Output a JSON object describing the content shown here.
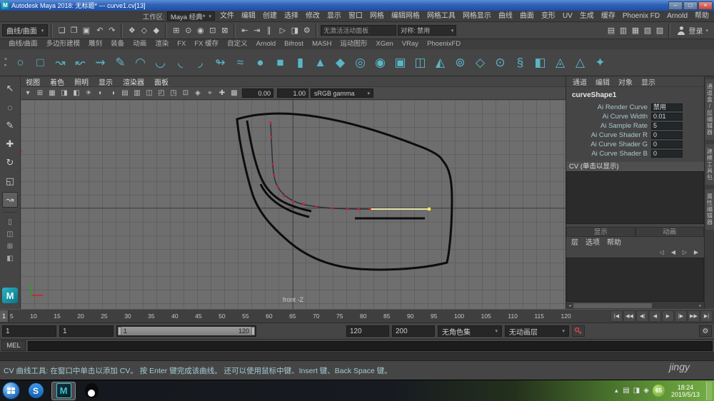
{
  "window": {
    "title": "Autodesk Maya 2018: 无标题* --- curve1.cv[13]",
    "app_icon_letter": "M",
    "min": "–",
    "max": "□",
    "close": "×"
  },
  "menubar": {
    "items": [
      "文件",
      "编辑",
      "创建",
      "选择",
      "修改",
      "显示",
      "窗口",
      "网格",
      "编辑网格",
      "网格工具",
      "网格显示",
      "曲线",
      "曲面",
      "变形",
      "UV",
      "生成",
      "缓存",
      "Phoenix FD",
      "Arnold",
      "帮助"
    ],
    "workspace_label": "工作区:",
    "workspace_value": "Maya 经典*"
  },
  "statusline": {
    "menuset": "曲线/曲面",
    "file_icons": [
      {
        "n": "new-scene-icon",
        "g": "❏"
      },
      {
        "n": "open-scene-icon",
        "g": "❐"
      },
      {
        "n": "save-scene-icon",
        "g": "▣"
      }
    ],
    "undo_icons": [
      {
        "n": "undo-icon",
        "g": "↶"
      },
      {
        "n": "redo-icon",
        "g": "↷"
      }
    ],
    "select_icons": [
      {
        "n": "select-hierarchy-icon",
        "g": "❖"
      },
      {
        "n": "select-object-icon",
        "g": "◇"
      },
      {
        "n": "select-component-icon",
        "g": "◆"
      }
    ],
    "snap_icons": [
      {
        "n": "snap-grid-icon",
        "g": "⊞"
      },
      {
        "n": "snap-curve-icon",
        "g": "⊙"
      },
      {
        "n": "snap-point-icon",
        "g": "◉"
      },
      {
        "n": "snap-plane-icon",
        "g": "⊡"
      },
      {
        "n": "snap-view-icon",
        "g": "⊠"
      }
    ],
    "history_icons": [
      {
        "n": "input-connections-icon",
        "g": "⇤"
      },
      {
        "n": "output-connections-icon",
        "g": "⇥"
      },
      {
        "n": "construction-history-icon",
        "g": "∥"
      }
    ],
    "render_icons": [
      {
        "n": "render-icon",
        "g": "▷"
      },
      {
        "n": "ipr-render-icon",
        "g": "◨"
      },
      {
        "n": "render-settings-icon",
        "g": "⚙"
      }
    ],
    "panel_field": "无激活活动面板",
    "symmetry": "对称: 禁用",
    "right_icons": [
      {
        "n": "grid-toggle-icon",
        "g": "▤"
      },
      {
        "n": "panel-toggle-icon",
        "g": "▥"
      },
      {
        "n": "outliner-toggle-icon",
        "g": "▦"
      },
      {
        "n": "attribute-toggle-icon",
        "g": "▧"
      },
      {
        "n": "toolbox-toggle-icon",
        "g": "▨"
      }
    ],
    "signin": "登录"
  },
  "shelf": {
    "left_controls": [
      {
        "n": "shelf-menu-icon",
        "g": "▾"
      },
      {
        "n": "shelf-edit-icon",
        "g": "▸"
      }
    ],
    "tabs": [
      "曲线/曲面",
      "多边形建模",
      "雕刻",
      "装备",
      "动画",
      "渲染",
      "FX",
      "FX 缓存",
      "自定义",
      "Arnold",
      "Bifrost",
      "MASH",
      "运动图形",
      "XGen",
      "VRay",
      "PhoenixFD"
    ],
    "icons": [
      {
        "n": "nurbs-circle-icon",
        "g": "○"
      },
      {
        "n": "nurbs-square-icon",
        "g": "□"
      },
      {
        "n": "cv-curve-tool-icon",
        "g": "↝"
      },
      {
        "n": "ep-curve-tool-icon",
        "g": "↜"
      },
      {
        "n": "bezier-curve-tool-icon",
        "g": "⇝"
      },
      {
        "n": "pencil-curve-tool-icon",
        "g": "✎"
      },
      {
        "n": "three-point-arc-icon",
        "g": "◠"
      },
      {
        "n": "two-point-arc-icon",
        "g": "◡"
      },
      {
        "n": "curve-fillet-icon",
        "g": "◟"
      },
      {
        "n": "insert-knot-icon",
        "g": "◞"
      },
      {
        "n": "extend-curve-icon",
        "g": "↬"
      },
      {
        "n": "offset-curve-icon",
        "g": "≈"
      },
      {
        "n": "nurbs-sphere-icon",
        "g": "●"
      },
      {
        "n": "nurbs-cube-icon",
        "g": "■"
      },
      {
        "n": "nurbs-cylinder-icon",
        "g": "▮"
      },
      {
        "n": "nurbs-cone-icon",
        "g": "▲"
      },
      {
        "n": "nurbs-plane-icon",
        "g": "◆"
      },
      {
        "n": "nurbs-torus-icon",
        "g": "◎"
      },
      {
        "n": "poly-sphere-icon",
        "g": "◉"
      },
      {
        "n": "poly-cube-icon",
        "g": "▣"
      },
      {
        "n": "poly-cylinder-icon",
        "g": "◫"
      },
      {
        "n": "poly-cone-icon",
        "g": "◭"
      },
      {
        "n": "poly-torus-icon",
        "g": "⊚"
      },
      {
        "n": "poly-plane-icon",
        "g": "◇"
      },
      {
        "n": "poly-disc-icon",
        "g": "⊙"
      },
      {
        "n": "poly-helix-icon",
        "g": "§"
      },
      {
        "n": "poly-pipe-icon",
        "g": "◧"
      },
      {
        "n": "poly-prism-icon",
        "g": "◬"
      },
      {
        "n": "poly-pyramid-icon",
        "g": "△"
      },
      {
        "n": "super-shape-icon",
        "g": "✦"
      }
    ]
  },
  "toolbox": {
    "tools": [
      {
        "n": "select-tool-icon",
        "g": "↖"
      },
      {
        "n": "lasso-tool-icon",
        "g": "◌"
      },
      {
        "n": "paint-select-tool-icon",
        "g": "✎"
      },
      {
        "n": "move-tool-icon",
        "g": "✚"
      },
      {
        "n": "rotate-tool-icon",
        "g": "↻"
      },
      {
        "n": "scale-tool-icon",
        "g": "◱"
      },
      {
        "n": "current-cv-curve-tool-icon",
        "g": "↝"
      }
    ],
    "layouts": [
      {
        "n": "layout-single-pane-icon",
        "g": "▯"
      },
      {
        "n": "layout-two-pane-icon",
        "g": "◫"
      },
      {
        "n": "layout-four-pane-icon",
        "g": "⊞"
      },
      {
        "n": "layout-outliner-icon",
        "g": "◧"
      }
    ],
    "logo_letter": "M"
  },
  "viewport": {
    "menus": [
      "视图",
      "着色",
      "照明",
      "显示",
      "渲染器",
      "面板"
    ],
    "icons": [
      {
        "n": "camera-select-icon",
        "g": "▾"
      },
      {
        "n": "grid-icon",
        "g": "⊞"
      },
      {
        "n": "film-gate-icon",
        "g": "▦"
      },
      {
        "n": "resolution-gate-icon",
        "g": "◨"
      },
      {
        "n": "gate-mask-icon",
        "g": "◧"
      },
      {
        "n": "lighting-icon",
        "g": "☀"
      },
      {
        "n": "shadows-icon",
        "g": "◐"
      },
      {
        "n": "ao-icon",
        "g": "◑"
      },
      {
        "n": "wireframe-icon",
        "g": "▤"
      },
      {
        "n": "shaded-icon",
        "g": "▥"
      },
      {
        "n": "textured-icon",
        "g": "◫"
      },
      {
        "n": "isolate-select-icon",
        "g": "◰"
      },
      {
        "n": "xray-icon",
        "g": "◳"
      },
      {
        "n": "joints-xray-icon",
        "g": "⊡"
      },
      {
        "n": "plugin-shading-icon",
        "g": "◈"
      },
      {
        "n": "snap-view-icon",
        "g": "⌖"
      },
      {
        "n": "manipulator-icon",
        "g": "✚"
      },
      {
        "n": "default-material-icon",
        "g": "▩"
      }
    ],
    "exposure": "0.00",
    "gamma": "1.00",
    "colorspace": "sRGB gamma",
    "camera_label": "front -Z"
  },
  "channelbox": {
    "menus": [
      "通道",
      "编辑",
      "对象",
      "显示"
    ],
    "object_name": "curveShape1",
    "attributes": [
      {
        "name": "Ai Render Curve",
        "value": "禁用"
      },
      {
        "name": "Ai Curve Width",
        "value": "0.01"
      },
      {
        "name": "Ai Sample Rate",
        "value": "5"
      },
      {
        "name": "Ai Curve Shader R",
        "value": "0"
      },
      {
        "name": "Ai Curve Shader G",
        "value": "0"
      },
      {
        "name": "Ai Curve Shader B",
        "value": "0"
      }
    ],
    "cv_label": "CV (单击以显示)",
    "layer_tabs": [
      "显示",
      "动画"
    ],
    "layer_menus": [
      "层",
      "选项",
      "帮助"
    ],
    "layer_icons": [
      {
        "n": "layer-prev-icon",
        "g": "◁"
      },
      {
        "n": "layer-first-icon",
        "g": "◀"
      },
      {
        "n": "layer-next-icon",
        "g": "▷"
      },
      {
        "n": "layer-last-icon",
        "g": "▶"
      }
    ]
  },
  "side_tabs": [
    "通道盒/层编辑器",
    "建模工具包",
    "属性编辑器"
  ],
  "timeline": {
    "current_frame": "1",
    "ticks": [
      5,
      10,
      15,
      20,
      25,
      30,
      35,
      40,
      45,
      50,
      55,
      60,
      65,
      70,
      75,
      80,
      85,
      90,
      95,
      100,
      105,
      110,
      115,
      120
    ],
    "playback": [
      {
        "n": "go-to-start-button",
        "g": "|◀"
      },
      {
        "n": "step-back-frame-button",
        "g": "◀◀"
      },
      {
        "n": "step-back-key-button",
        "g": "◀|"
      },
      {
        "n": "play-backwards-button",
        "g": "◀"
      },
      {
        "n": "play-forwards-button",
        "g": "▶"
      },
      {
        "n": "step-forward-key-button",
        "g": "|▶"
      },
      {
        "n": "step-forward-frame-button",
        "g": "▶▶"
      },
      {
        "n": "go-to-end-button",
        "g": "▶|"
      }
    ]
  },
  "range": {
    "anim_start": "1",
    "play_start": "1",
    "bar_start": "1",
    "bar_end": "120",
    "play_end": "120",
    "anim_end": "200",
    "character_set": "无角色集",
    "anim_layer": "无动画层"
  },
  "command": {
    "label": "MEL"
  },
  "helpline": {
    "text": "CV 曲线工具: 在窗口中单击以添加 CV。 按 Enter 键完成该曲线。 还可以使用鼠标中键、Insert 键、Back Space 键。"
  },
  "watermark": "jingy",
  "taskbar": {
    "sogou_letter": "S",
    "maya_letter": "M",
    "tray_icons": [
      {
        "n": "tray-document-icon",
        "g": "▤"
      },
      {
        "n": "tray-network-icon",
        "g": "◨"
      },
      {
        "n": "tray-volume-icon",
        "g": "◈"
      }
    ],
    "tray_badge": "65",
    "clock_time": "18:24",
    "clock_date": "2019/5/13"
  }
}
